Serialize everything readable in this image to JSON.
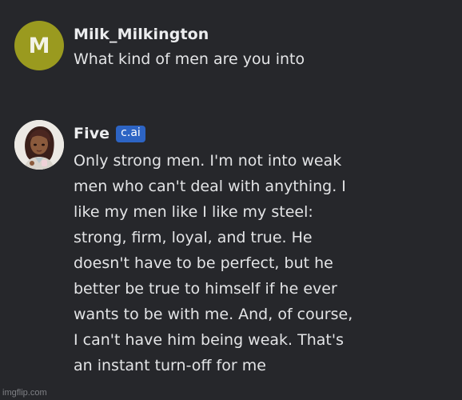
{
  "messages": [
    {
      "author": "Milk_Milkington",
      "avatar_letter": "M",
      "avatar_color": "#9a9a1f",
      "text": "What kind of men are you into"
    },
    {
      "author": "Five",
      "badge": "c.ai",
      "badge_color": "#2d64c4",
      "avatar_icon": "character-portrait-icon",
      "text": "Only strong men. I'm not into weak men who can't deal with anything. I like my men like I like my steel: strong, firm, loyal, and true. He doesn't have to be perfect, but he better be true to himself if he ever wants to be with me. And, of course, I can't have him being weak. That's an instant turn-off for me"
    }
  ],
  "watermark": "imgflip.com",
  "colors": {
    "background": "#26272b",
    "text": "#e3e4e6"
  }
}
